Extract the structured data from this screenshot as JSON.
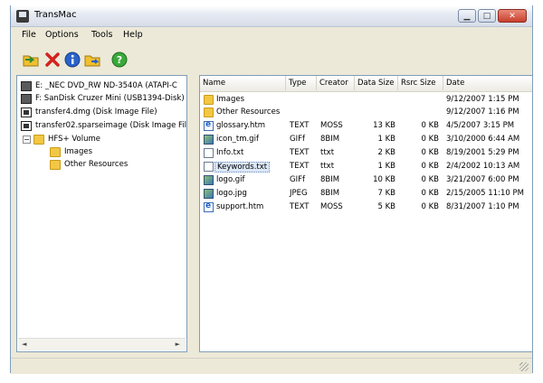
{
  "window": {
    "title": "TransMac"
  },
  "menu": [
    "File",
    "Options",
    "Tools",
    "Help"
  ],
  "toolbar": [
    "open-folder-icon",
    "delete-icon",
    "info-icon",
    "copy-folder-icon",
    "help-icon"
  ],
  "tree": {
    "items": [
      {
        "label": "E: _NEC DVD_RW ND-3540A (ATAPI-C",
        "icon": "disk-icon"
      },
      {
        "label": "F: SanDisk Cruzer Mini (USB1394-Disk)",
        "icon": "disk-icon"
      },
      {
        "label": "transfer4.dmg (Disk Image File)",
        "icon": "dmg-icon"
      },
      {
        "label": "transfer02.sparseimage (Disk Image File)",
        "icon": "dmg-icon"
      },
      {
        "label": "HFS+ Volume",
        "icon": "folder-icon",
        "expander": "−"
      },
      {
        "label": "Images",
        "icon": "folder-icon"
      },
      {
        "label": "Other Resources",
        "icon": "folder-icon"
      }
    ]
  },
  "list": {
    "columns": [
      "Name",
      "Type",
      "Creator",
      "Data Size",
      "Rsrc Size",
      "Date"
    ],
    "rows": [
      {
        "name": "Images",
        "type": "",
        "creator": "",
        "data": "",
        "rsrc": "",
        "date": "9/12/2007 1:15 PM",
        "icon": "folder"
      },
      {
        "name": "Other Resources",
        "type": "",
        "creator": "",
        "data": "",
        "rsrc": "",
        "date": "9/12/2007 1:16 PM",
        "icon": "folder"
      },
      {
        "name": "glossary.htm",
        "type": "TEXT",
        "creator": "MOSS",
        "data": "13 KB",
        "rsrc": "0 KB",
        "date": "4/5/2007 3:15 PM",
        "icon": "htm"
      },
      {
        "name": "icon_tm.gif",
        "type": "GIFf",
        "creator": "8BIM",
        "data": "1 KB",
        "rsrc": "0 KB",
        "date": "3/10/2000 6:44 AM",
        "icon": "img"
      },
      {
        "name": "Info.txt",
        "type": "TEXT",
        "creator": "ttxt",
        "data": "2 KB",
        "rsrc": "0 KB",
        "date": "8/19/2001 5:29 PM",
        "icon": "file"
      },
      {
        "name": "Keywords.txt",
        "type": "TEXT",
        "creator": "ttxt",
        "data": "1 KB",
        "rsrc": "0 KB",
        "date": "2/4/2002 10:13 AM",
        "icon": "file",
        "selected": true
      },
      {
        "name": "logo.gif",
        "type": "GIFf",
        "creator": "8BIM",
        "data": "10 KB",
        "rsrc": "0 KB",
        "date": "3/21/2007 6:00 PM",
        "icon": "img"
      },
      {
        "name": "logo.jpg",
        "type": "JPEG",
        "creator": "8BIM",
        "data": "7 KB",
        "rsrc": "0 KB",
        "date": "2/15/2005 11:10 PM",
        "icon": "img"
      },
      {
        "name": "support.htm",
        "type": "TEXT",
        "creator": "MOSS",
        "data": "5 KB",
        "rsrc": "0 KB",
        "date": "8/31/2007 1:10 PM",
        "icon": "htm"
      }
    ]
  }
}
